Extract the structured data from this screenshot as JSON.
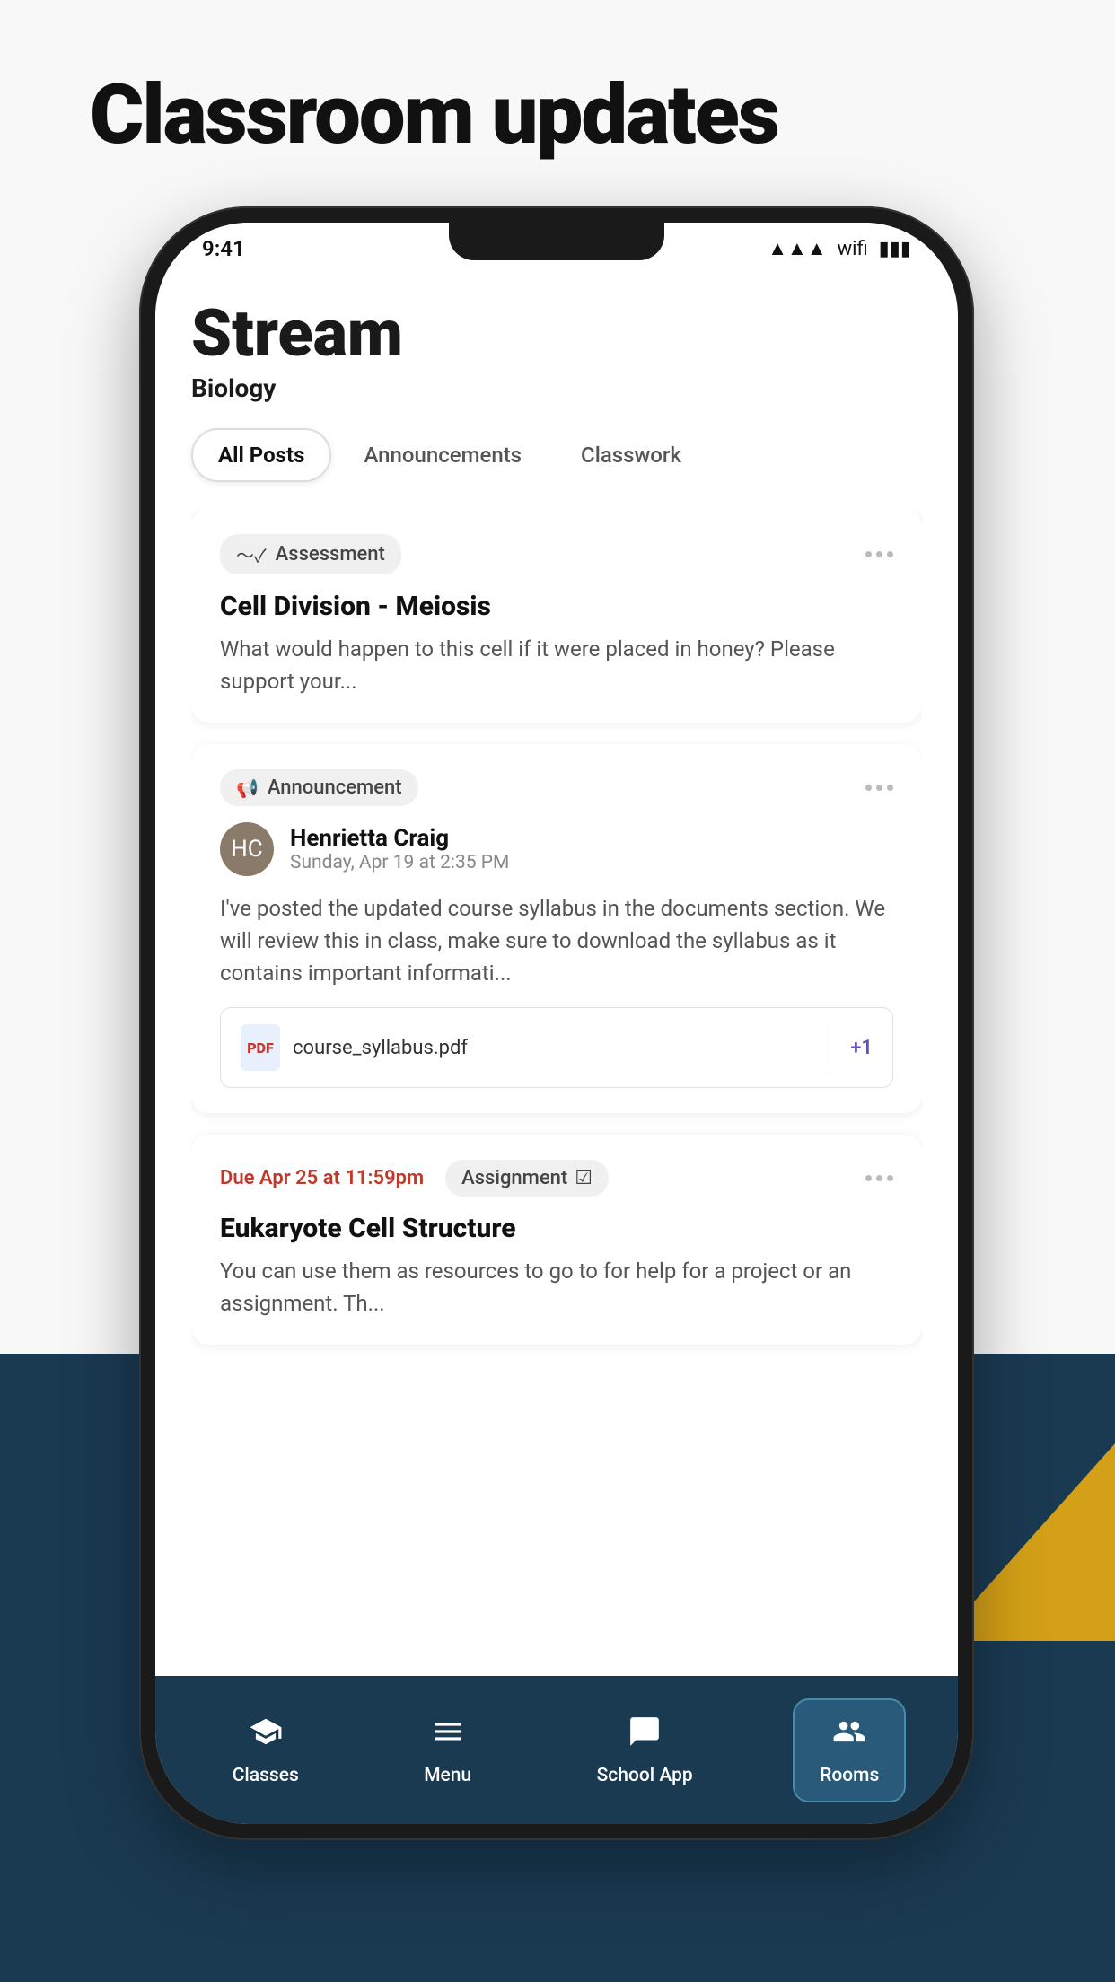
{
  "page": {
    "title": "Classroom updates"
  },
  "stream": {
    "title": "Stream",
    "subtitle": "Biology"
  },
  "tabs": [
    {
      "label": "All Posts",
      "active": true
    },
    {
      "label": "Announcements",
      "active": false
    },
    {
      "label": "Classwork",
      "active": false
    }
  ],
  "cards": [
    {
      "type": "assessment",
      "badge": "Assessment",
      "title": "Cell Division - Meiosis",
      "body": "What would happen to this cell if it were placed in honey? Please support your..."
    },
    {
      "type": "announcement",
      "badge": "Announcement",
      "user_name": "Henrietta Craig",
      "user_date": "Sunday, Apr 19 at 2:35 PM",
      "body": "I've posted the updated course syllabus in the documents section. We will review this in class, make sure to download the syllabus as it contains important informati...",
      "attachment": "course_syllabus.pdf",
      "attachment_extra": "+1"
    },
    {
      "type": "assignment",
      "due": "Due Apr 25 at 11:59pm",
      "badge": "Assignment",
      "title": "Eukaryote Cell Structure",
      "body": "You can use them as resources to go to for help for a project or an assignment. Th..."
    }
  ],
  "nav": [
    {
      "label": "Classes",
      "icon": "🎓",
      "active": false
    },
    {
      "label": "Menu",
      "icon": "☰",
      "active": false
    },
    {
      "label": "School App",
      "icon": "💬",
      "active": false
    },
    {
      "label": "Rooms",
      "icon": "👥",
      "active": true
    }
  ]
}
